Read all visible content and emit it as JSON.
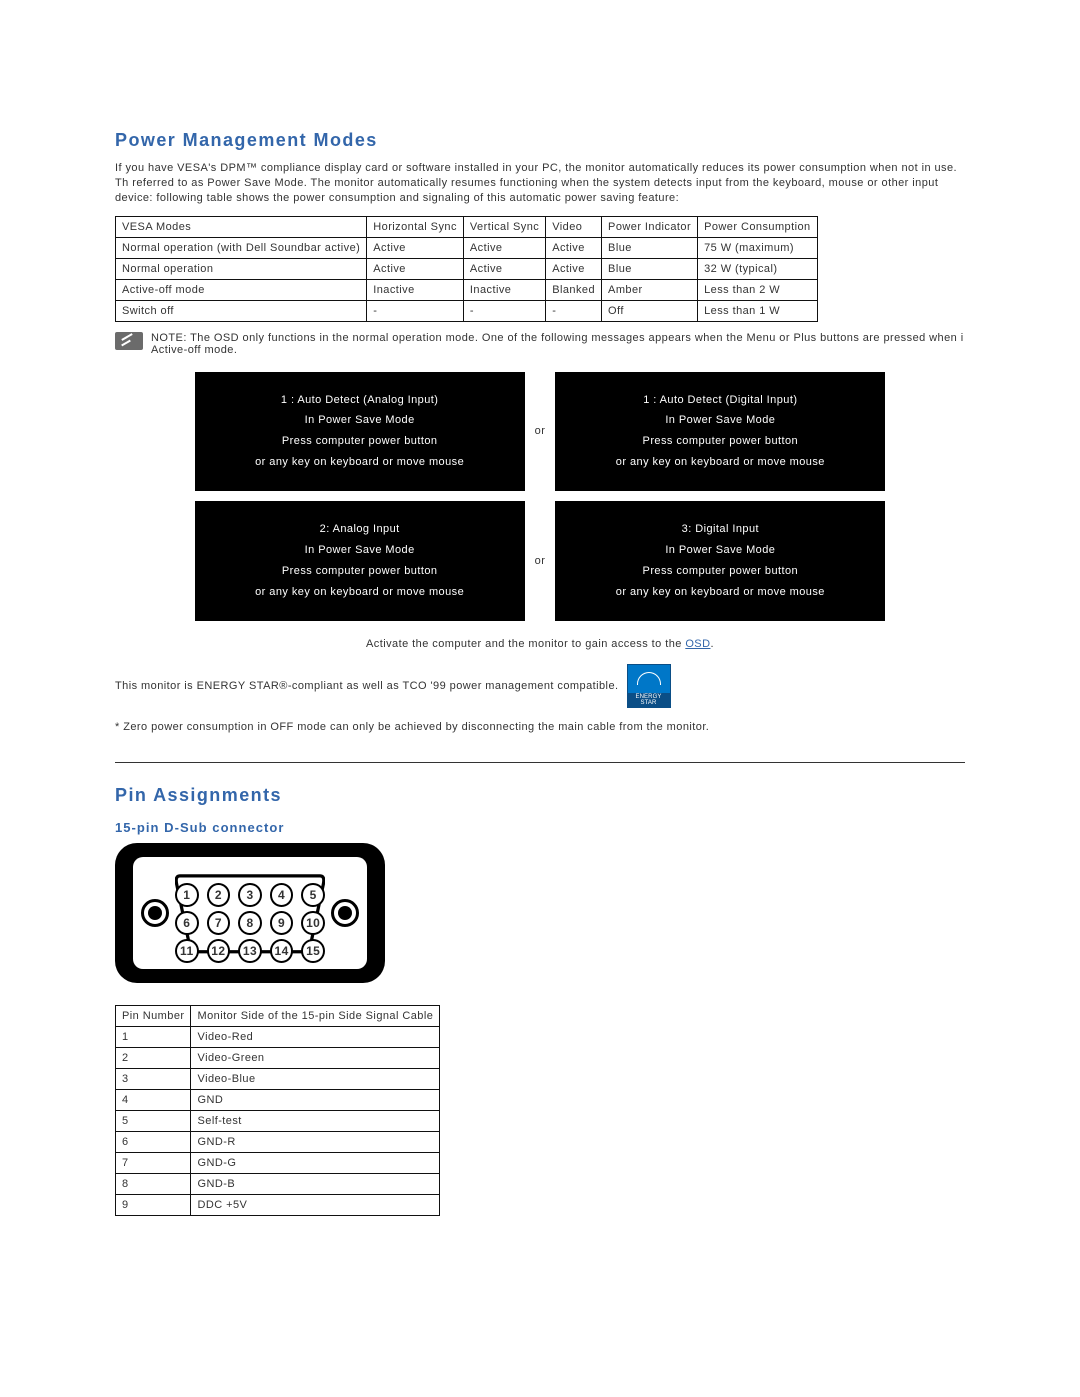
{
  "sections": {
    "pmm_title": "Power Management Modes",
    "intro_p": "If you have VESA's DPM™ compliance display card or software installed in your PC, the monitor automatically reduces its power consumption when not in use. Th referred to as Power Save Mode. The monitor automatically resumes functioning when the system detects input from the keyboard, mouse or other input device: following table shows the power consumption and signaling of this automatic power saving feature:",
    "note_text": "NOTE: The OSD only functions in the normal operation mode. One of the following messages appears when the Menu or Plus buttons are pressed when i Active-off mode.",
    "activate_pre": "Activate the computer and the monitor to gain access to the ",
    "activate_link": "OSD",
    "period": ".",
    "es_text": "This monitor is ENERGY STAR®-compliant as well as TCO '99 power management compatible.",
    "es_badge": "ENERGY STAR",
    "zero_text": "* Zero power consumption in OFF mode can only be achieved by disconnecting the main cable from the monitor.",
    "pin_title": "Pin Assignments",
    "dsub_title": "15-pin D-Sub connector"
  },
  "vesa_table": {
    "headers": [
      "VESA Modes",
      "Horizontal Sync",
      "Vertical Sync",
      "Video",
      "Power Indicator",
      "Power Consumption"
    ],
    "rows": [
      [
        "Normal operation (with Dell Soundbar active)",
        "Active",
        "Active",
        "Active",
        "Blue",
        "75 W (maximum)"
      ],
      [
        "Normal operation",
        "Active",
        "Active",
        "Active",
        "Blue",
        "32 W (typical)"
      ],
      [
        "Active-off mode",
        "Inactive",
        "Inactive",
        "Blanked",
        "Amber",
        "Less than 2 W"
      ],
      [
        "Switch off",
        "-",
        "-",
        "-",
        "Off",
        "Less than 1 W"
      ]
    ]
  },
  "messages": {
    "or": "or",
    "box1": [
      "1 : Auto Detect (Analog Input)",
      "In Power Save Mode",
      "Press computer power button",
      "or any key on keyboard or move mouse"
    ],
    "box2": [
      "1 : Auto Detect (Digital Input)",
      "In Power Save Mode",
      "Press computer power button",
      "or any key on keyboard or move mouse"
    ],
    "box3": [
      "2: Analog Input",
      "In Power Save Mode",
      "Press computer power button",
      "or any key on keyboard or move mouse"
    ],
    "box4": [
      "3: Digital Input",
      "In Power Save Mode",
      "Press computer power button",
      "or any key on keyboard or move mouse"
    ]
  },
  "pin_table": {
    "headers": [
      "Pin Number",
      "Monitor Side of the 15-pin Side Signal Cable"
    ],
    "rows": [
      [
        "1",
        "Video-Red"
      ],
      [
        "2",
        "Video-Green"
      ],
      [
        "3",
        "Video-Blue"
      ],
      [
        "4",
        "GND"
      ],
      [
        "5",
        "Self-test"
      ],
      [
        "6",
        "GND-R"
      ],
      [
        "7",
        "GND-G"
      ],
      [
        "8",
        "GND-B"
      ],
      [
        "9",
        "DDC +5V"
      ]
    ]
  },
  "dsub_pins": {
    "row1": [
      "1",
      "2",
      "3",
      "4",
      "5"
    ],
    "row2": [
      "6",
      "7",
      "8",
      "9",
      "10"
    ],
    "row3": [
      "11",
      "12",
      "13",
      "14",
      "15"
    ]
  }
}
